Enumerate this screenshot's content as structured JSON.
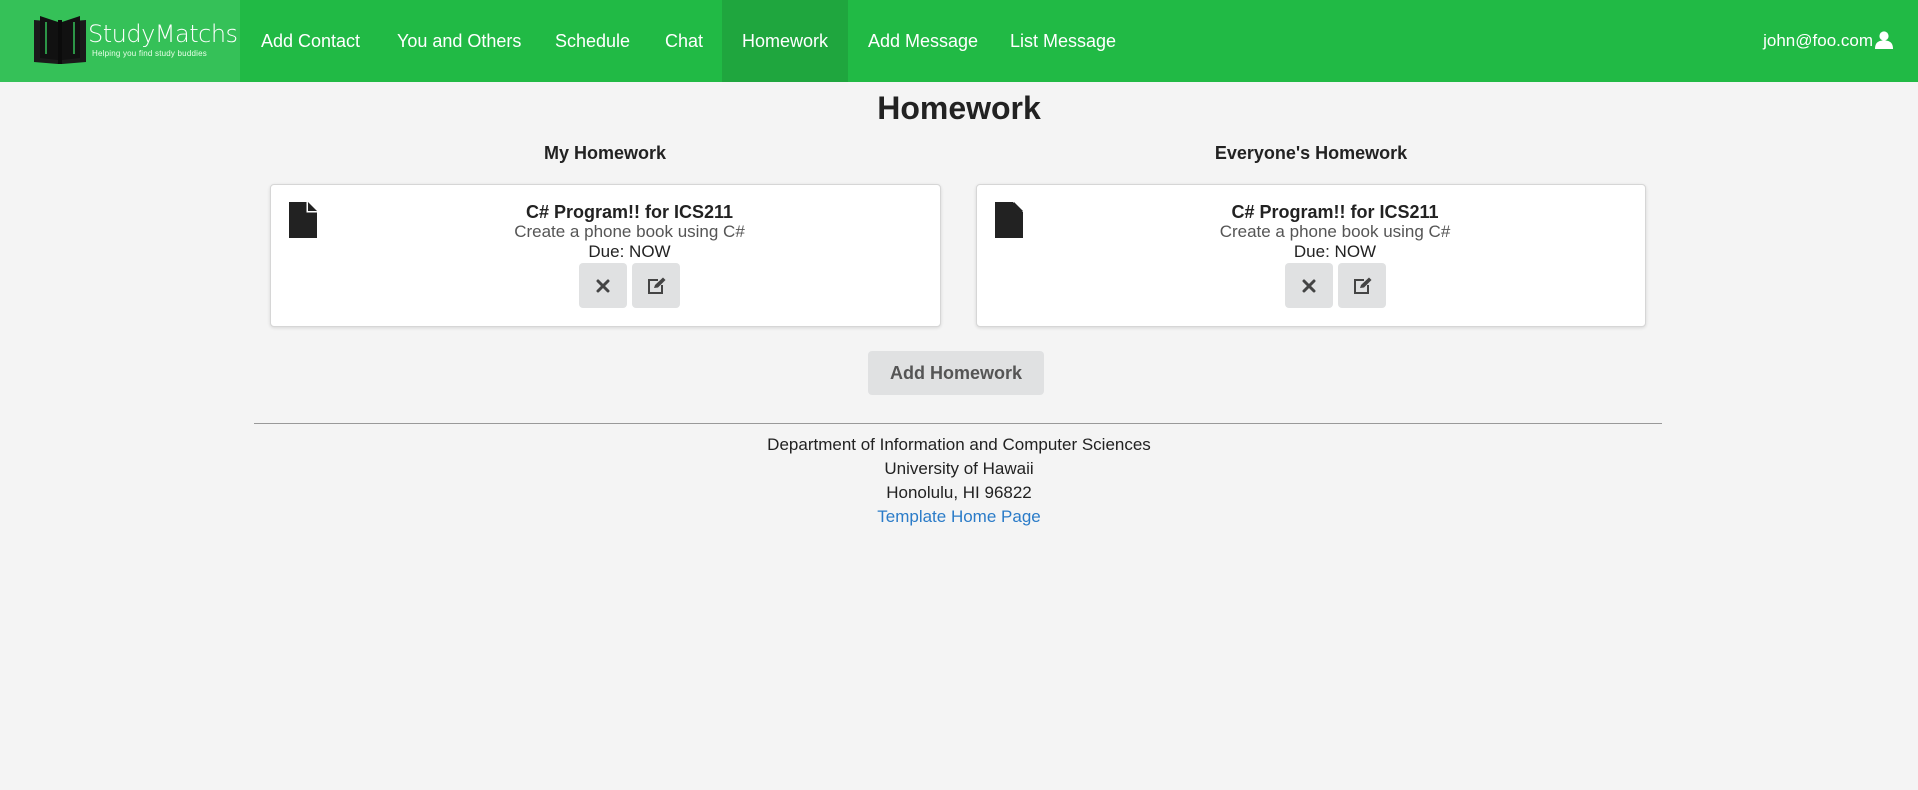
{
  "brand": {
    "name": "StudyMatchs",
    "tagline": "Helping you find study buddies"
  },
  "nav": {
    "items": [
      {
        "label": "Add Contact"
      },
      {
        "label": "You and Others"
      },
      {
        "label": "Schedule"
      },
      {
        "label": "Chat"
      },
      {
        "label": "Homework",
        "active": true
      },
      {
        "label": "Add Message"
      },
      {
        "label": "List Message"
      }
    ],
    "user_email": "john@foo.com"
  },
  "page": {
    "title": "Homework"
  },
  "my_homework": {
    "heading": "My Homework",
    "item": {
      "title": "C# Program!! for ICS211",
      "description": "Create a phone book using C#",
      "due": "Due: NOW"
    }
  },
  "everyone_homework": {
    "heading": "Everyone's Homework",
    "item": {
      "title": "C# Program!! for ICS211",
      "description": "Create a phone book using C#",
      "due": "Due: NOW"
    }
  },
  "actions": {
    "add_homework": "Add Homework"
  },
  "footer": {
    "line1": "Department of Information and Computer Sciences",
    "line2": "University of Hawaii",
    "line3": "Honolulu, HI 96822",
    "link": "Template Home Page"
  },
  "colors": {
    "nav_bg": "#21ba45",
    "nav_active": "#1fa63e",
    "brand_bg": "#35c158",
    "link": "#2a7bc8",
    "button_bg": "#e0e1e2"
  },
  "icons": [
    "book-logo-icon",
    "user-icon",
    "file-icon",
    "delete-icon",
    "edit-icon"
  ]
}
